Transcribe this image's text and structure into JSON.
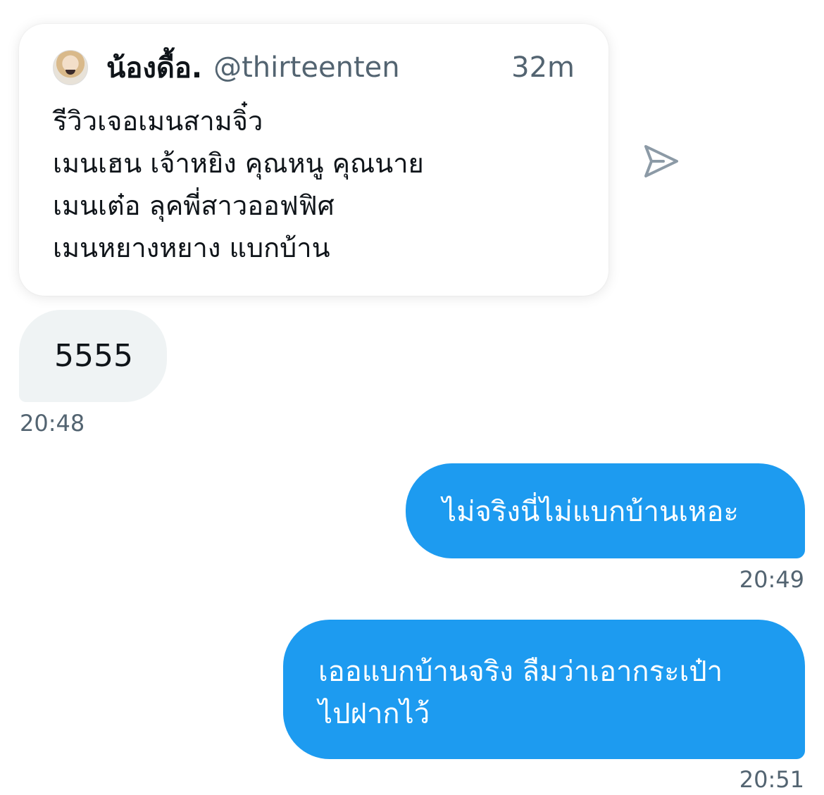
{
  "quoted_tweet": {
    "display_name": "น้องดื้อ.",
    "handle": "@thirteenten",
    "time_ago": "32m",
    "avatar_icon": "profile-avatar",
    "lines": [
      "รีวิวเจอเมนสามจิ๋ว",
      "เมนเฮน เจ้าหยิง คุณหนู คุณนาย",
      "เมนเต๋อ ลุคพี่สาวออฟฟิศ",
      "เมนหยางหยาง แบกบ้าน"
    ]
  },
  "share_icon": "send-arrow-icon",
  "messages": [
    {
      "direction": "incoming",
      "text": "5555",
      "time": "20:48"
    },
    {
      "direction": "outgoing",
      "text": "ไม่จริงนี่ไม่แบกบ้านเหอะ",
      "time": "20:49"
    },
    {
      "direction": "outgoing",
      "lines": [
        "เออแบกบ้านจริง ลืมว่าเอากระเป๋า",
        "ไปฝากไว้"
      ],
      "time": "20:51"
    }
  ],
  "colors": {
    "outgoing_bubble": "#1d9bf0",
    "incoming_bubble": "#eff3f4",
    "secondary_text": "#536471",
    "primary_text": "#0f1419"
  }
}
